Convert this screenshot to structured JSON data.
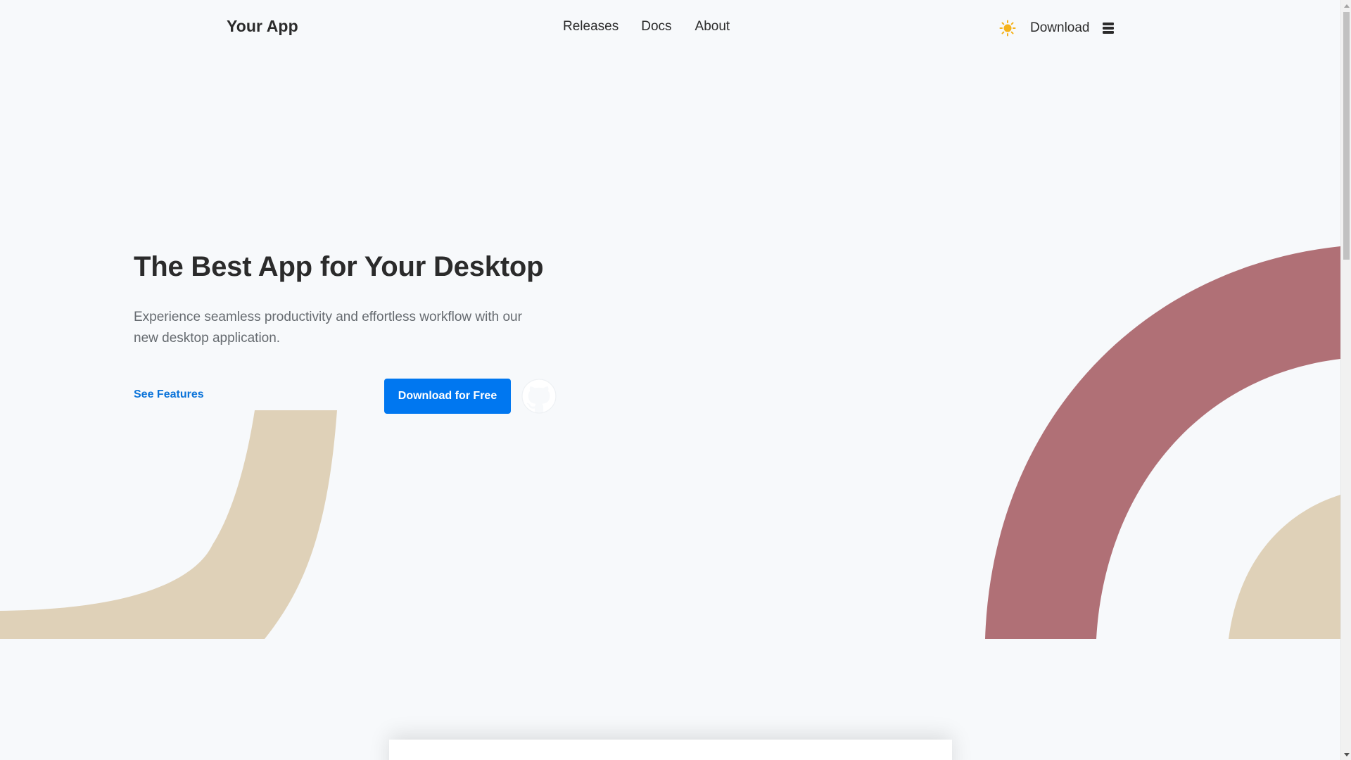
{
  "nav": {
    "brand": "Your App",
    "links": [
      "Releases",
      "Docs",
      "About"
    ],
    "download": "Download",
    "theme_icon": "sun-icon",
    "menu_icon": "menu-icon"
  },
  "hero": {
    "title": "The Best App for Your Desktop",
    "subtitle": "Experience seamless productivity and effortless workflow with our new desktop application.",
    "see_features": "See Features",
    "download_button": "Download for Free",
    "github_icon": "github-icon"
  },
  "colors": {
    "accent": "#0077f0",
    "link": "#0a73d9",
    "shape_rose": "#b07076",
    "shape_sand": "#dfd1b8",
    "background": "#f7f9fb"
  }
}
